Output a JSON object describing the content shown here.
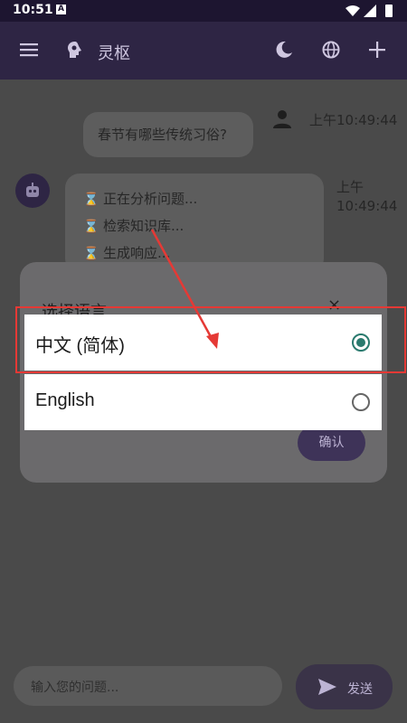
{
  "status_bar": {
    "time": "10:51",
    "notif_badge": "A"
  },
  "app_bar": {
    "title": "灵枢"
  },
  "chat": {
    "user_message": "春节有哪些传统习俗?",
    "user_time": "上午10:49:44",
    "bot_steps": [
      "正在分析问题...",
      "检索知识库...",
      "生成响应..."
    ],
    "bot_time_line1": "上午",
    "bot_time_line2": "10:49:44"
  },
  "dialog": {
    "title": "选择语言",
    "close_glyph": "×",
    "confirm_label": "确认",
    "options": [
      {
        "label": "中文 (简体)",
        "selected": true
      },
      {
        "label": "English",
        "selected": false
      }
    ]
  },
  "input": {
    "placeholder": "输入您的问题...",
    "send_label": "发送"
  },
  "colors": {
    "accent": "#2a7a6e",
    "highlight": "#e53935",
    "appbar": "#2e2544"
  }
}
